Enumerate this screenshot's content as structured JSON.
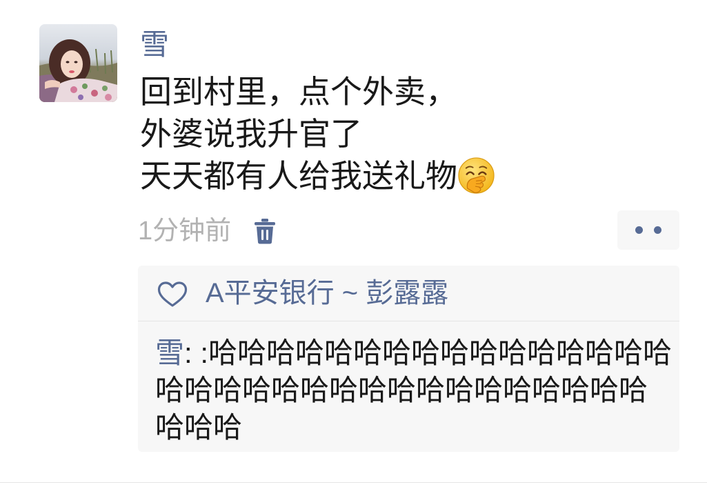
{
  "post": {
    "author": "雪",
    "lines": [
      "回到村里，点个外卖，",
      "外婆说我升官了",
      "天天都有人给我送礼物"
    ],
    "trailing_emoji_icon": "face-with-hand-over-mouth-icon",
    "time": "1分钟前"
  },
  "likes": {
    "icon": "heart-outline-icon",
    "names": "A平安银行 ~ 彭露露"
  },
  "comments": [
    {
      "author": "雪",
      "separator": ": ",
      "text": ":哈哈哈哈哈哈哈哈哈哈哈哈哈哈哈哈哈哈哈哈哈哈哈哈哈哈哈哈哈哈哈哈哈哈哈哈"
    }
  ],
  "icons": {
    "delete": "trash-icon",
    "more": "more-dots-icon"
  },
  "colors": {
    "link": "#576b95",
    "text": "#191919",
    "meta": "#b2b2b2",
    "panel": "#f7f7f7",
    "divider": "#e5e5e5",
    "background": "#ffffff"
  }
}
